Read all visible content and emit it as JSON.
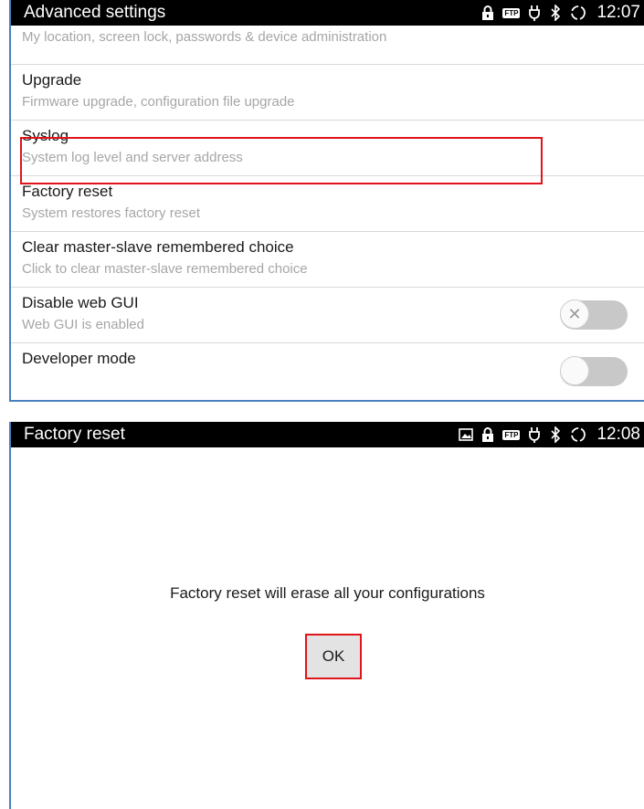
{
  "top": {
    "statusbar": {
      "title": "Advanced settings",
      "time": "12:07",
      "ftp_label": "FTP"
    },
    "items": [
      {
        "title": "",
        "subtitle": "My location, screen lock, passwords & device administration"
      },
      {
        "title": "Upgrade",
        "subtitle": "Firmware upgrade, configuration file upgrade"
      },
      {
        "title": "Syslog",
        "subtitle": "System log level and server address"
      },
      {
        "title": "Factory reset",
        "subtitle": "System restores factory reset"
      },
      {
        "title": "Clear master-slave remembered choice",
        "subtitle": "Click to clear master-slave remembered choice"
      },
      {
        "title": "Disable web GUI",
        "subtitle": "Web GUI is enabled",
        "toggle_state": "off"
      },
      {
        "title": "Developer mode",
        "subtitle": "",
        "toggle_state": "off"
      }
    ]
  },
  "bottom": {
    "statusbar": {
      "title": "Factory reset",
      "time": "12:08",
      "ftp_label": "FTP"
    },
    "message": "Factory reset will erase all your configurations",
    "ok_label": "OK"
  },
  "colors": {
    "highlight": "#e0141b",
    "statusbar_bg": "#000000",
    "frame": "#4a7fbf"
  },
  "icons": [
    "lock-icon",
    "ftp-icon",
    "usb-icon",
    "bluetooth-icon",
    "sync-icon",
    "image-icon"
  ]
}
